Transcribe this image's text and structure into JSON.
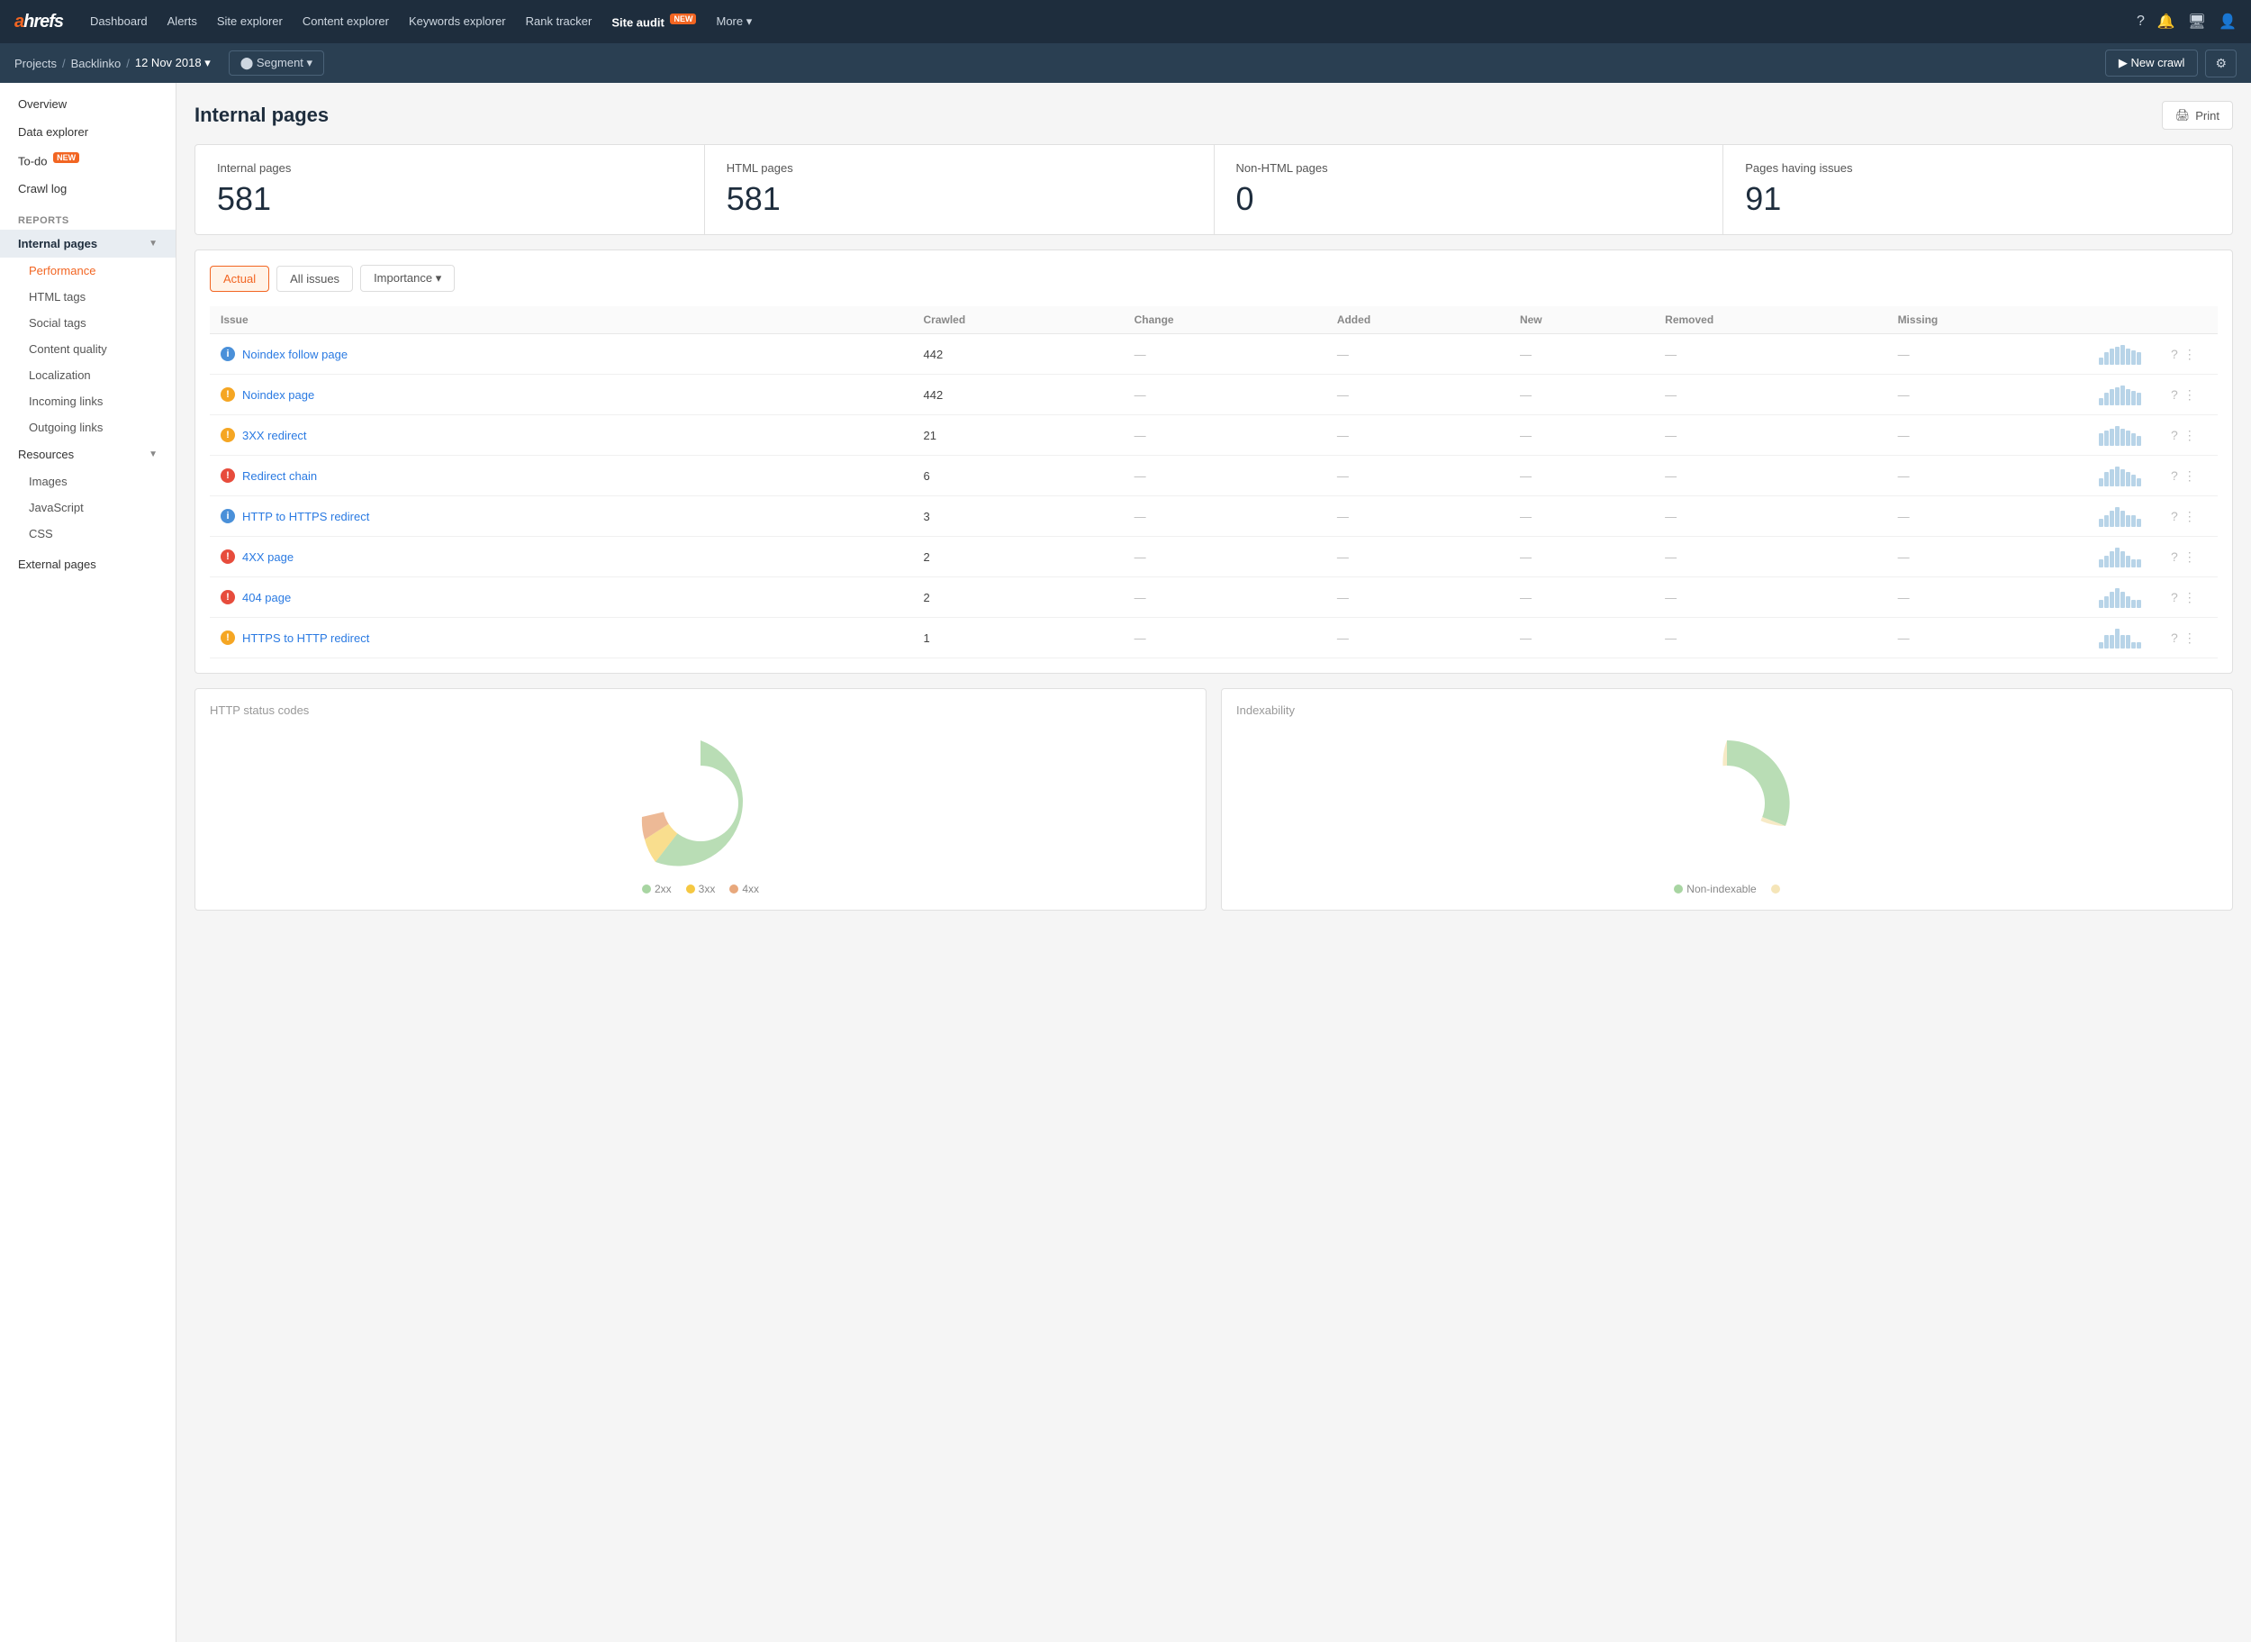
{
  "nav": {
    "logo": "ahrefs",
    "links": [
      {
        "label": "Dashboard",
        "active": false
      },
      {
        "label": "Alerts",
        "active": false
      },
      {
        "label": "Site explorer",
        "active": false
      },
      {
        "label": "Content explorer",
        "active": false
      },
      {
        "label": "Keywords explorer",
        "active": false
      },
      {
        "label": "Rank tracker",
        "active": false
      },
      {
        "label": "Site audit",
        "active": true,
        "new": true
      },
      {
        "label": "More ▾",
        "active": false
      }
    ]
  },
  "breadcrumb": {
    "parts": [
      "Projects",
      "Backlinko",
      "12 Nov 2018 ▾"
    ],
    "segment": "⬤ Segment ▾",
    "new_crawl": "▶ New crawl",
    "settings": "⚙"
  },
  "sidebar": {
    "top_links": [
      {
        "label": "Overview"
      },
      {
        "label": "Data explorer"
      },
      {
        "label": "To-do",
        "new": true
      },
      {
        "label": "Crawl log"
      }
    ],
    "reports_label": "REPORTS",
    "active_item": "Internal pages",
    "sub_links": [
      {
        "label": "Performance",
        "active": true
      },
      {
        "label": "HTML tags"
      },
      {
        "label": "Social tags"
      },
      {
        "label": "Content quality"
      },
      {
        "label": "Localization"
      },
      {
        "label": "Incoming links"
      },
      {
        "label": "Outgoing links"
      }
    ],
    "resources_label": "Resources",
    "resources_links": [
      {
        "label": "Images"
      },
      {
        "label": "JavaScript"
      },
      {
        "label": "CSS"
      }
    ],
    "bottom_links": [
      {
        "label": "External pages"
      }
    ]
  },
  "page": {
    "title": "Internal pages",
    "print_label": "Print"
  },
  "stats": [
    {
      "label": "Internal pages",
      "value": "581"
    },
    {
      "label": "HTML pages",
      "value": "581"
    },
    {
      "label": "Non-HTML pages",
      "value": "0"
    },
    {
      "label": "Pages having issues",
      "value": "91"
    }
  ],
  "filters": {
    "actual": "Actual",
    "all_issues": "All issues",
    "importance": "Importance ▾"
  },
  "table": {
    "columns": [
      "Issue",
      "Crawled",
      "Change",
      "Added",
      "New",
      "Removed",
      "Missing"
    ],
    "rows": [
      {
        "type": "info",
        "name": "Noindex follow page",
        "crawled": "442",
        "change": "—",
        "added": "—",
        "new": "—",
        "removed": "—",
        "missing": "—",
        "bars": [
          8,
          14,
          18,
          20,
          22,
          18,
          16,
          14
        ]
      },
      {
        "type": "warn",
        "name": "Noindex page",
        "crawled": "442",
        "change": "—",
        "added": "—",
        "new": "—",
        "removed": "—",
        "missing": "—",
        "bars": [
          8,
          14,
          18,
          20,
          22,
          18,
          16,
          14
        ]
      },
      {
        "type": "warn",
        "name": "3XX redirect",
        "crawled": "21",
        "change": "—",
        "added": "—",
        "new": "—",
        "removed": "—",
        "missing": "—",
        "bars": [
          10,
          12,
          14,
          16,
          14,
          12,
          10,
          8
        ]
      },
      {
        "type": "error",
        "name": "Redirect chain",
        "crawled": "6",
        "change": "—",
        "added": "—",
        "new": "—",
        "removed": "—",
        "missing": "—",
        "bars": [
          6,
          10,
          12,
          14,
          12,
          10,
          8,
          6
        ]
      },
      {
        "type": "info",
        "name": "HTTP to HTTPS redirect",
        "crawled": "3",
        "change": "—",
        "added": "—",
        "new": "—",
        "removed": "—",
        "missing": "—",
        "bars": [
          4,
          6,
          8,
          10,
          8,
          6,
          6,
          4
        ]
      },
      {
        "type": "error",
        "name": "4XX page",
        "crawled": "2",
        "change": "—",
        "added": "—",
        "new": "—",
        "removed": "—",
        "missing": "—",
        "bars": [
          4,
          6,
          8,
          10,
          8,
          6,
          4,
          4
        ]
      },
      {
        "type": "error",
        "name": "404 page",
        "crawled": "2",
        "change": "—",
        "added": "—",
        "new": "—",
        "removed": "—",
        "missing": "—",
        "bars": [
          4,
          6,
          8,
          10,
          8,
          6,
          4,
          4
        ]
      },
      {
        "type": "warn",
        "name": "HTTPS to HTTP redirect",
        "crawled": "1",
        "change": "—",
        "added": "—",
        "new": "—",
        "removed": "—",
        "missing": "—",
        "bars": [
          2,
          4,
          4,
          6,
          4,
          4,
          2,
          2
        ]
      }
    ]
  },
  "charts": {
    "http_status": {
      "title": "HTTP status codes",
      "legend": [
        {
          "color": "#a8d5a2",
          "label": "2xx"
        },
        {
          "color": "#f5c842",
          "label": "3xx"
        },
        {
          "color": "#e8a87c",
          "label": "4xx"
        }
      ]
    },
    "indexability": {
      "title": "Indexability",
      "legend": [
        {
          "color": "#a8d5a2",
          "label": "Non-indexable"
        },
        {
          "color": "#f5e5b8",
          "label": ""
        }
      ]
    }
  }
}
